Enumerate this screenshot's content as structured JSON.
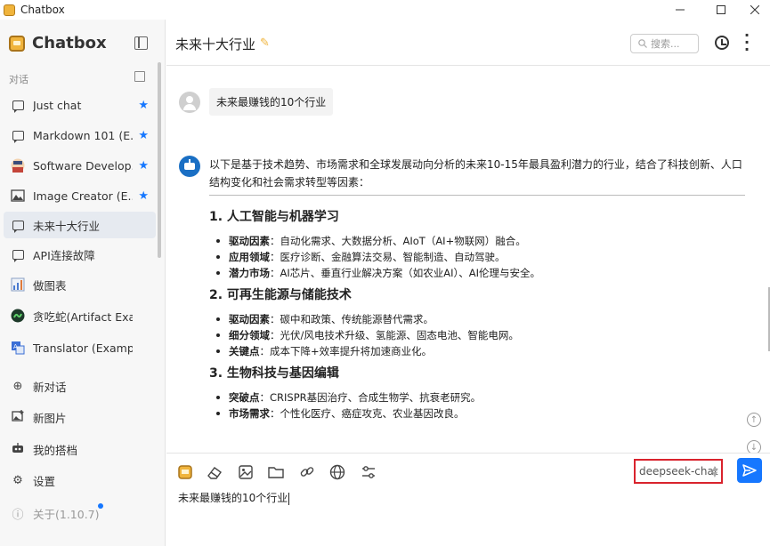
{
  "window": {
    "title": "Chatbox",
    "controls": [
      "minimize",
      "maximize",
      "close"
    ]
  },
  "sidebar": {
    "brand": "Chatbox",
    "section_label": "对话",
    "conversations": [
      {
        "label": "Just chat",
        "icon": "chat-bubble-icon",
        "starred": true
      },
      {
        "label": "Markdown 101 (E...",
        "icon": "chat-bubble-icon",
        "starred": true
      },
      {
        "label": "Software Develop...",
        "icon": "developer-avatar-icon",
        "starred": true
      },
      {
        "label": "Image Creator (E...",
        "icon": "image-icon",
        "starred": true
      },
      {
        "label": "未来十大行业",
        "icon": "chat-bubble-icon",
        "starred": false,
        "active": true
      },
      {
        "label": "API连接故障",
        "icon": "chat-bubble-icon",
        "starred": false
      },
      {
        "label": "做图表",
        "icon": "chart-icon",
        "starred": false
      },
      {
        "label": "贪吃蛇(Artifact Example)",
        "icon": "snake-avatar-icon",
        "starred": false
      },
      {
        "label": "Translator (Example)",
        "icon": "translate-icon",
        "starred": false
      }
    ],
    "menu": [
      {
        "label": "新对话",
        "icon": "plus-circle-icon"
      },
      {
        "label": "新图片",
        "icon": "new-image-icon"
      },
      {
        "label": "我的搭档",
        "icon": "robot-icon"
      },
      {
        "label": "设置",
        "icon": "gear-icon"
      },
      {
        "label": "关于(1.10.7)",
        "icon": "info-icon"
      }
    ]
  },
  "header": {
    "title": "未来十大行业",
    "search_placeholder": "搜索..."
  },
  "messages": {
    "user": "未来最赚钱的10个行业",
    "assistant": {
      "intro": "以下是基于技术趋势、市场需求和全球发展动向分析的未来10-15年最具盈利潜力的行业，结合了科技创新、人口结构变化和社会需求转型等因素：",
      "sections": [
        {
          "title": "1. 人工智能与机器学习",
          "bullets": [
            {
              "key": "驱动因素",
              "text": "：自动化需求、大数据分析、AIoT（AI+物联网）融合。"
            },
            {
              "key": "应用领域",
              "text": "：医疗诊断、金融算法交易、智能制造、自动驾驶。"
            },
            {
              "key": "潜力市场",
              "text": "：AI芯片、垂直行业解决方案（如农业AI）、AI伦理与安全。"
            }
          ]
        },
        {
          "title": "2. 可再生能源与储能技术",
          "bullets": [
            {
              "key": "驱动因素",
              "text": "：碳中和政策、传统能源替代需求。"
            },
            {
              "key": "细分领域",
              "text": "：光伏/风电技术升级、氢能源、固态电池、智能电网。"
            },
            {
              "key": "关键点",
              "text": "：成本下降+效率提升将加速商业化。"
            }
          ]
        },
        {
          "title": "3. 生物科技与基因编辑",
          "bullets": [
            {
              "key": "突破点",
              "text": "：CRISPR基因治疗、合成生物学、抗衰老研究。"
            },
            {
              "key": "市场需求",
              "text": "：个性化医疗、癌症攻克、农业基因改良。"
            }
          ]
        }
      ]
    }
  },
  "composer": {
    "model": "deepseek-chat",
    "input_value": "未来最赚钱的10个行业"
  },
  "colors": {
    "accent": "#1677ff",
    "highlight_border": "#d9232d",
    "brand": "#f0b43c"
  }
}
